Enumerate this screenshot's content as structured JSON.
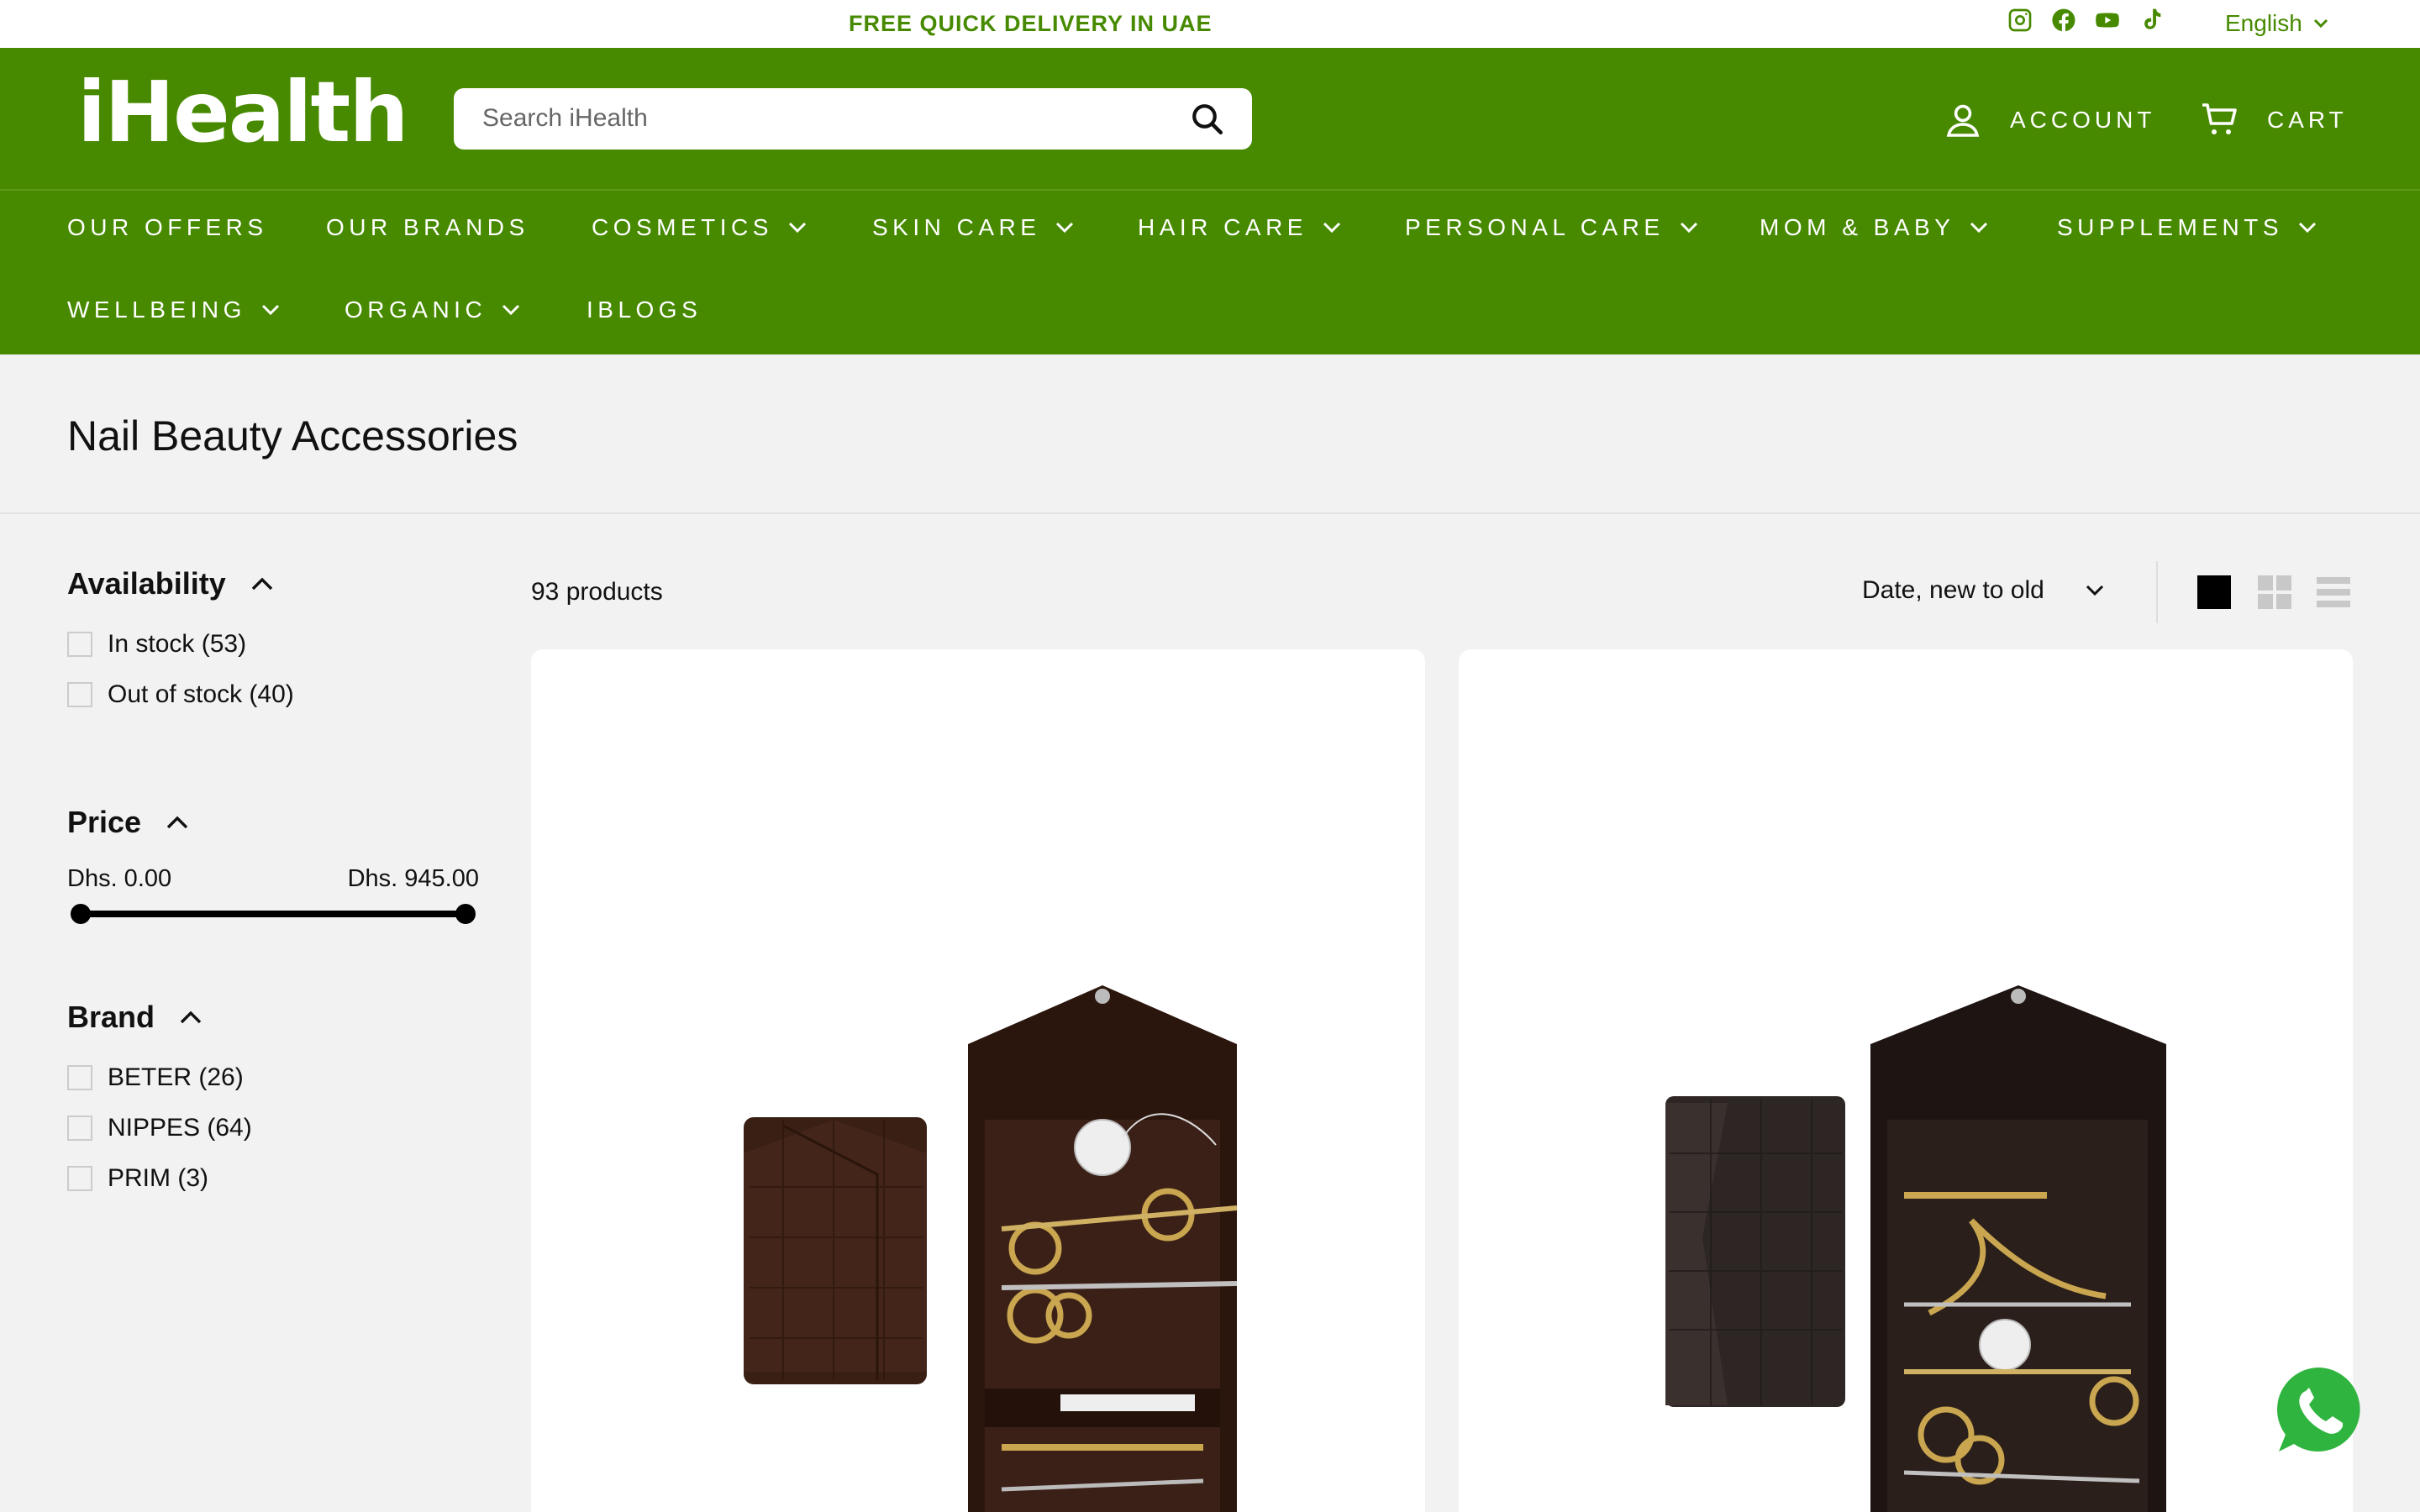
{
  "announcement": {
    "text": "FREE QUICK DELIVERY IN UAE"
  },
  "social": [
    "instagram-icon",
    "facebook-icon",
    "youtube-icon",
    "tiktok-icon"
  ],
  "language": {
    "selected": "English"
  },
  "header": {
    "logo": "iHealth",
    "search_placeholder": "Search iHealth",
    "account_label": "ACCOUNT",
    "cart_label": "CART"
  },
  "nav": {
    "items": [
      {
        "label": "OUR OFFERS"
      },
      {
        "label": "OUR BRANDS"
      },
      {
        "label": "COSMETICS"
      },
      {
        "label": "SKIN CARE"
      },
      {
        "label": "HAIR CARE"
      },
      {
        "label": "PERSONAL CARE"
      },
      {
        "label": "MOM & BABY"
      },
      {
        "label": "SUPPLEMENTS"
      },
      {
        "label": "WELLBEING"
      },
      {
        "label": "ORGANIC"
      },
      {
        "label": "IBLOGS"
      }
    ]
  },
  "page": {
    "title": "Nail Beauty Accessories"
  },
  "filters": {
    "availability": {
      "title": "Availability",
      "options": [
        {
          "label": "In stock (53)"
        },
        {
          "label": "Out of stock (40)"
        }
      ]
    },
    "price": {
      "title": "Price",
      "min_label": "Dhs. 0.00",
      "max_label": "Dhs. 945.00",
      "range_fraction": [
        0,
        1
      ]
    },
    "brand": {
      "title": "Brand",
      "options": [
        {
          "label": "BETER (26)"
        },
        {
          "label": "NIPPES (64)"
        },
        {
          "label": "PRIM (3)"
        }
      ]
    }
  },
  "toolbar": {
    "product_count": "93 products",
    "sort_selected": "Date, new to old",
    "view_active": "large-grid"
  },
  "colors": {
    "brand_green": "#478a00",
    "background": "#f2f2f2",
    "whatsapp_green": "#2fb43f"
  }
}
